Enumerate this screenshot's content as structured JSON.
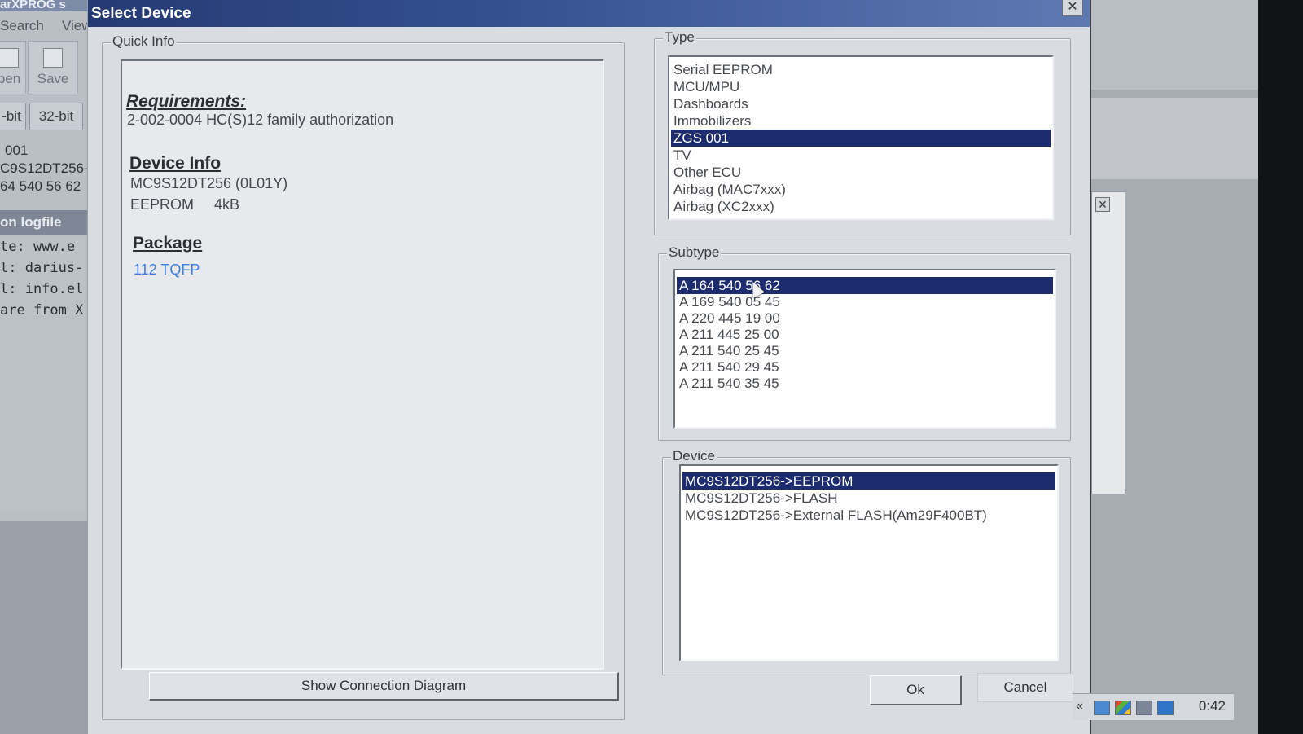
{
  "background_app": {
    "title_fragment": "arXPROG s",
    "menu": [
      "Search",
      "View"
    ],
    "toolbar": [
      "pen",
      "Save"
    ],
    "bit_buttons": [
      "-bit",
      "32-bit"
    ],
    "info_lines": [
      "001",
      "C9S12DT256-",
      "64 540 56 62"
    ],
    "logfile_header": "on logfile",
    "log_lines": [
      "te: www.e",
      "l: darius-",
      "l: info.el",
      "are from X"
    ]
  },
  "dialog": {
    "title": "Select Device",
    "quick_info": {
      "label": "Quick Info",
      "requirements_heading": "Requirements:",
      "requirements_text": "2-002-0004  HC(S)12 family authorization",
      "device_info_heading": "Device Info",
      "device_info_line1": "MC9S12DT256 (0L01Y)",
      "device_info_line2": "EEPROM     4kB",
      "package_heading": "Package",
      "package_link": "112 TQFP",
      "show_diagram_button": "Show Connection Diagram"
    },
    "type": {
      "label": "Type",
      "items": [
        "Serial EEPROM",
        "MCU/MPU",
        "Dashboards",
        "Immobilizers",
        "ZGS 001",
        "TV",
        "Other ECU",
        "Airbag (MAC7xxx)",
        "Airbag (XC2xxx)"
      ],
      "selected": "ZGS 001"
    },
    "subtype": {
      "label": "Subtype",
      "items": [
        "A 164 540 56 62",
        "A 169 540 05 45",
        "A 220 445 19 00",
        "A 211 445 25 00",
        "A 211 540 25 45",
        "A 211 540 29 45",
        "A 211 540 35 45"
      ],
      "selected": "A 164 540 56 62"
    },
    "device": {
      "label": "Device",
      "items": [
        "MC9S12DT256->EEPROM",
        "MC9S12DT256->FLASH",
        "MC9S12DT256->External FLASH(Am29F400BT)"
      ],
      "selected": "MC9S12DT256->EEPROM"
    },
    "ok_button": "Ok",
    "cancel_button": "Cancel"
  },
  "tray": {
    "expand_label": "«",
    "clock": "0:42"
  }
}
